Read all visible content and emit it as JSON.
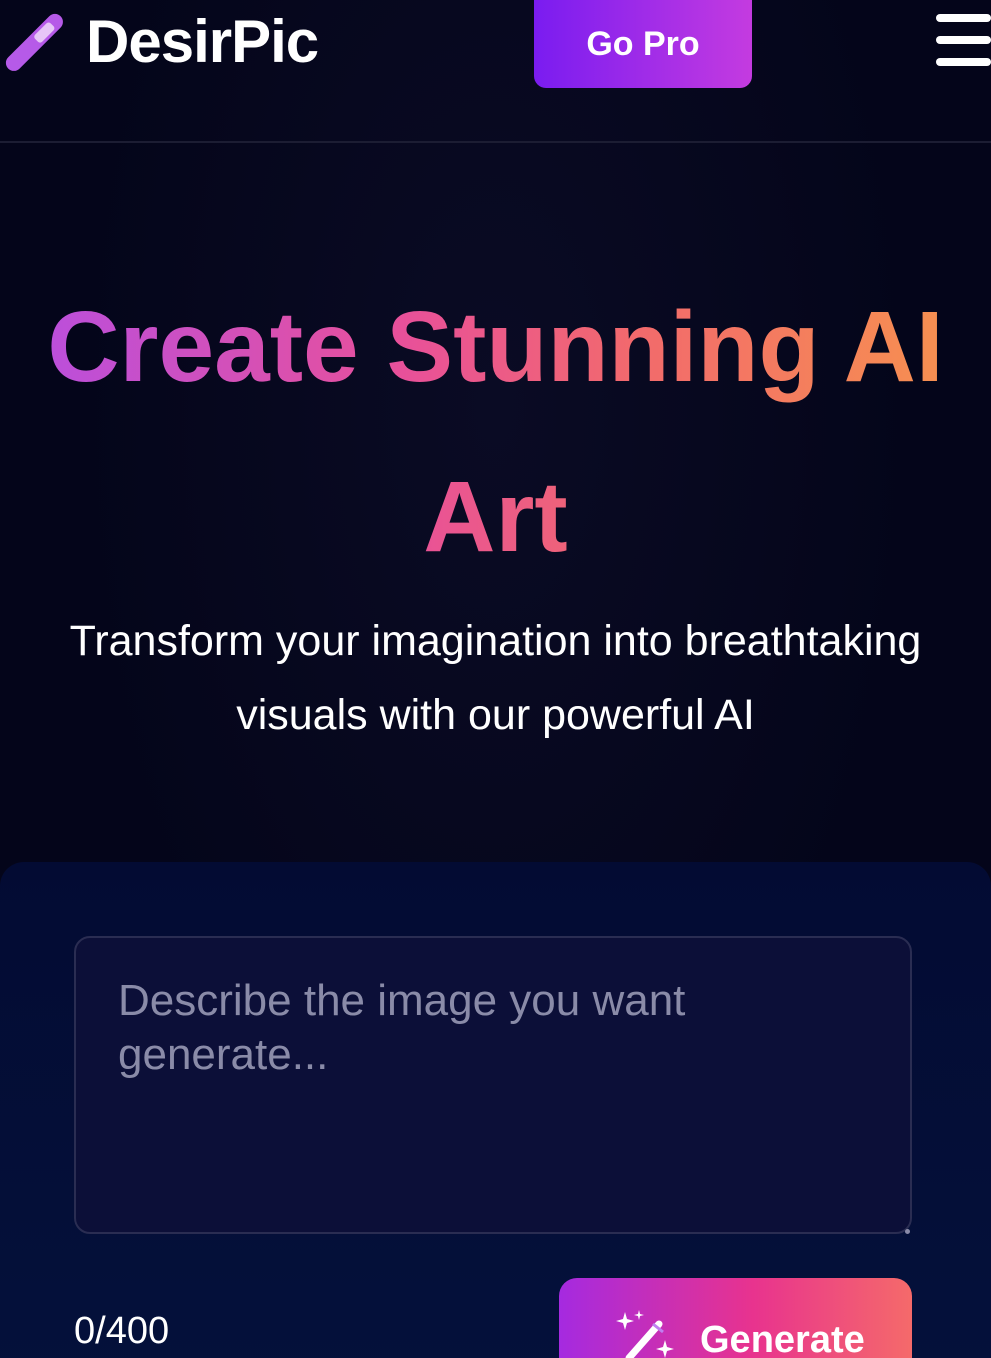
{
  "header": {
    "brand": "DesirPic",
    "go_pro_label": "Go Pro",
    "logo_icon": "pen-icon",
    "menu_icon": "hamburger-menu-icon"
  },
  "hero": {
    "title": "Create Stunning AI Art",
    "subtitle": "Transform your imagination into breathtaking visuals with our powerful AI"
  },
  "generator": {
    "prompt_placeholder": "Describe the image you want generate...",
    "prompt_value": "",
    "char_count": "0/400",
    "generate_label": "Generate",
    "generate_icon": "magic-wand-icon"
  },
  "colors": {
    "background": "#04051a",
    "accent_purple": "#7a1cf0",
    "accent_pink": "#e8338e",
    "accent_orange": "#f7934e"
  }
}
